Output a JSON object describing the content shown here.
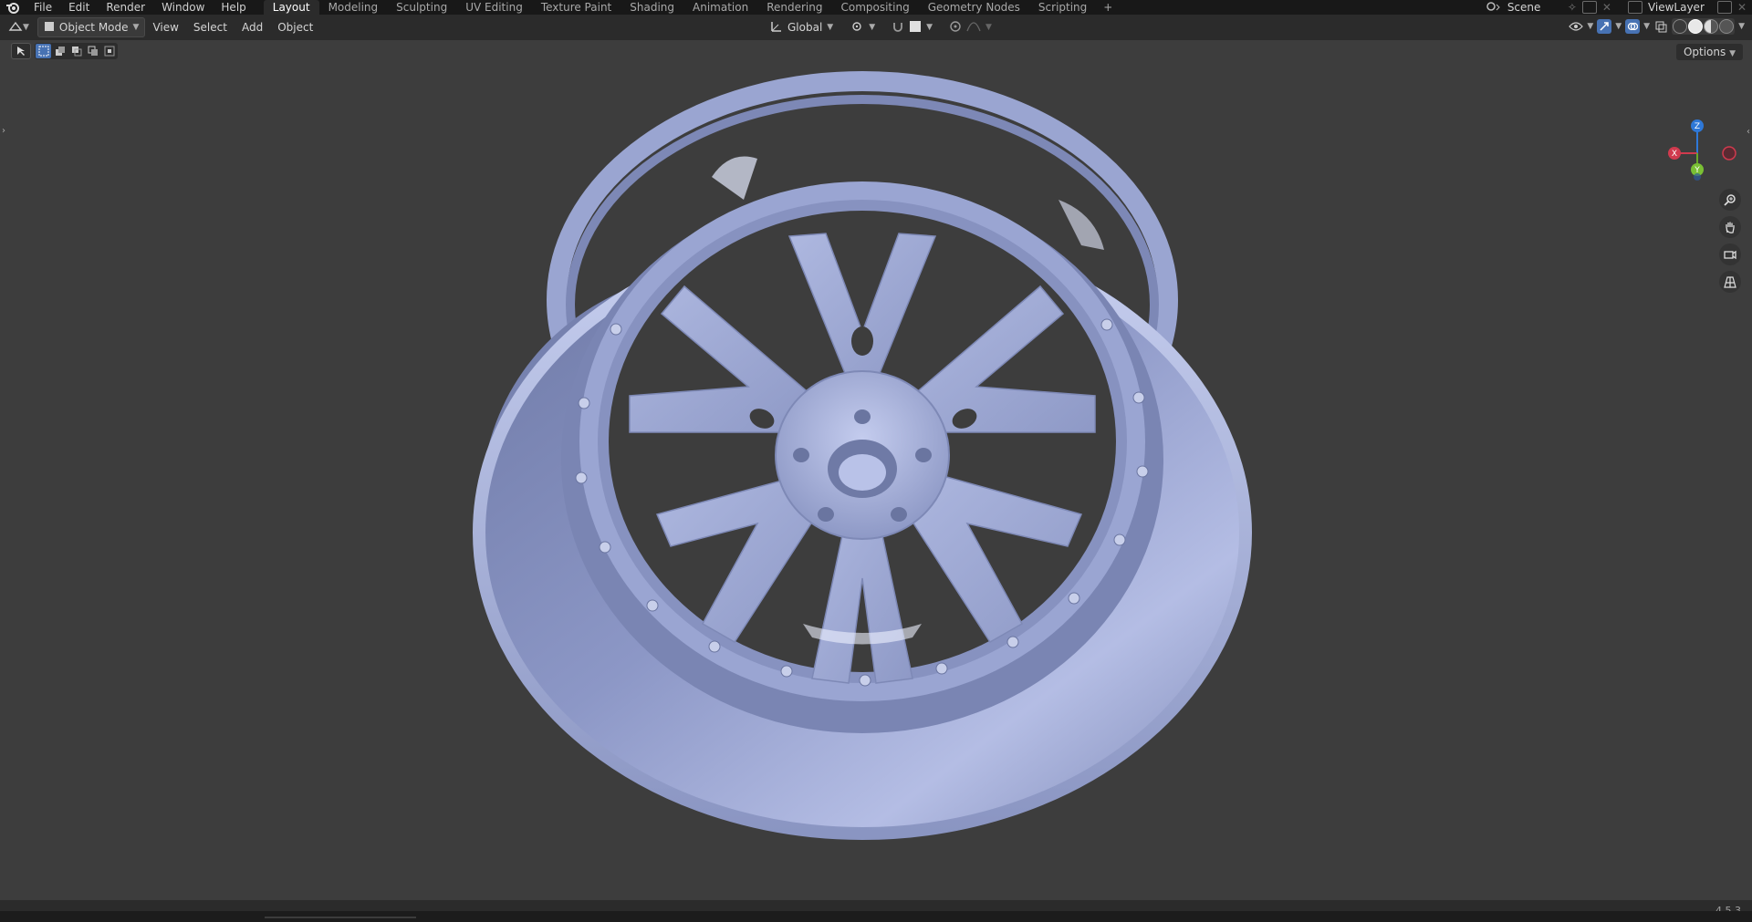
{
  "topbar": {
    "menus": [
      "File",
      "Edit",
      "Render",
      "Window",
      "Help"
    ],
    "workspaces": [
      "Layout",
      "Modeling",
      "Sculpting",
      "UV Editing",
      "Texture Paint",
      "Shading",
      "Animation",
      "Rendering",
      "Compositing",
      "Geometry Nodes",
      "Scripting"
    ],
    "active_workspace": "Layout",
    "add_tab": "+",
    "scene": "Scene",
    "view_layer": "ViewLayer"
  },
  "header": {
    "mode": "Object Mode",
    "menus": [
      "View",
      "Select",
      "Add",
      "Object"
    ],
    "orientation": "Global"
  },
  "toolbar": {
    "options_label": "Options"
  },
  "gizmo": {
    "x_label": "X",
    "y_label": "Y",
    "z_label": "Z"
  },
  "status": {
    "version": "4.5.3"
  },
  "colors": {
    "accent": "#4772b3",
    "wheel": "#a7b2d9",
    "background": "#3d3d3d"
  }
}
